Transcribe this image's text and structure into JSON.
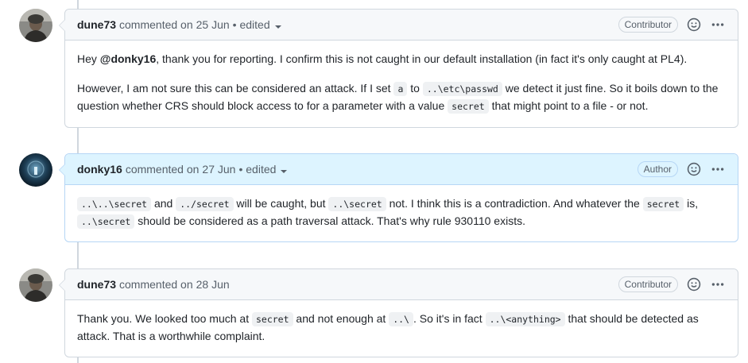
{
  "colors": {
    "border": "#d0d7de",
    "header_bg": "#f6f8fa",
    "author_header_bg": "#ddf4ff",
    "author_border": "#b6d6f5",
    "muted_text": "#57606a",
    "text": "#1f2328",
    "code_bg": "#eff1f3"
  },
  "comments": [
    {
      "username": "dune73",
      "action": "commented on",
      "date": "25 Jun",
      "edited": "• edited",
      "badge": "Contributor",
      "emoji_icon": "smiley-icon",
      "menu_icon": "kebab-horizontal-icon",
      "body": {
        "p1": {
          "t1": "Hey ",
          "mention": "@donky16",
          "t2": ", thank you for reporting. I confirm this is not caught in our default installation (in fact it's only caught at PL4)."
        },
        "p2": {
          "t1": "However, I am not sure this can be considered an attack. If I set ",
          "c1": "a",
          "t2": " to ",
          "c2": "..\\etc\\passwd",
          "t3": " we detect it just fine. So it boils down to the question whether CRS should block access to for a parameter with a value ",
          "c3": "secret",
          "t4": " that might point to a file - or not."
        }
      }
    },
    {
      "username": "donky16",
      "action": "commented on",
      "date": "27 Jun",
      "edited": "• edited",
      "badge": "Author",
      "emoji_icon": "smiley-icon",
      "menu_icon": "kebab-horizontal-icon",
      "body": {
        "p1": {
          "c1": "..\\..\\secret",
          "t1": " and ",
          "c2": "../secret",
          "t2": " will be caught, but ",
          "c3": "..\\secret",
          "t3": " not. I think this is a contradiction. And whatever the ",
          "c4": "secret",
          "t4": " is, ",
          "c5": "..\\secret",
          "t5": " should be considered as a path traversal attack. That's why rule 930110 exists."
        }
      }
    },
    {
      "username": "dune73",
      "action": "commented on",
      "date": "28 Jun",
      "badge": "Contributor",
      "emoji_icon": "smiley-icon",
      "menu_icon": "kebab-horizontal-icon",
      "body": {
        "p1": {
          "t1": "Thank you. We looked too much at ",
          "c1": "secret",
          "t2": " and not enough at ",
          "c2": "..\\",
          "t3": ". So it's in fact ",
          "c3": "..\\<anything>",
          "t4": " that should be detected as attack. That is a worthwhile complaint."
        }
      }
    }
  ]
}
